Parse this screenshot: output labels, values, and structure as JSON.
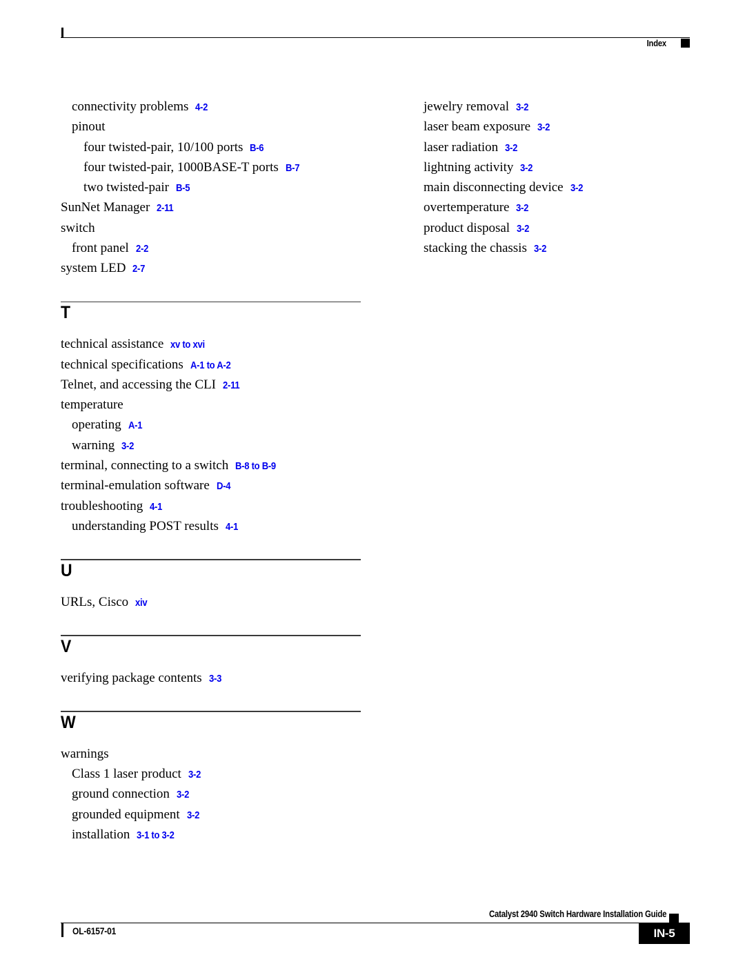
{
  "header": {
    "label": "Index",
    "marker": "black-square"
  },
  "colors": {
    "page_reference": "#0000ee",
    "text": "#000000",
    "rule": "#3a3a3a"
  },
  "columns": {
    "left": {
      "entries": [
        {
          "term": "connectivity problems",
          "ref": "4-2",
          "level": 1
        },
        {
          "term": "pinout",
          "ref": "",
          "level": 1
        },
        {
          "term": "four twisted-pair, 10/100 ports",
          "ref": "B-6",
          "level": 2
        },
        {
          "term": "four twisted-pair, 1000BASE-T ports",
          "ref": "B-7",
          "level": 2
        },
        {
          "term": "two twisted-pair",
          "ref": "B-5",
          "level": 2
        },
        {
          "term": "SunNet Manager",
          "ref": "2-11",
          "level": 0
        },
        {
          "term": "switch",
          "ref": "",
          "level": 0
        },
        {
          "term": "front panel",
          "ref": "2-2",
          "level": 1
        },
        {
          "term": "system LED",
          "ref": "2-7",
          "level": 0
        }
      ],
      "sections": [
        {
          "letter": "T",
          "entries": [
            {
              "term": "technical assistance",
              "ref": "xv to xvi",
              "level": 0
            },
            {
              "term": "technical specifications",
              "ref": "A-1 to A-2",
              "level": 0
            },
            {
              "term": "Telnet, and accessing the CLI",
              "ref": "2-11",
              "level": 0
            },
            {
              "term": "temperature",
              "ref": "",
              "level": 0
            },
            {
              "term": "operating",
              "ref": "A-1",
              "level": 1
            },
            {
              "term": "warning",
              "ref": "3-2",
              "level": 1
            },
            {
              "term": "terminal, connecting to a switch",
              "ref": "B-8 to B-9",
              "level": 0
            },
            {
              "term": "terminal-emulation software",
              "ref": "D-4",
              "level": 0
            },
            {
              "term": "troubleshooting",
              "ref": "4-1",
              "level": 0
            },
            {
              "term": "understanding POST results",
              "ref": "4-1",
              "level": 1
            }
          ]
        },
        {
          "letter": "U",
          "entries": [
            {
              "term": "URLs, Cisco",
              "ref": "xiv",
              "level": 0
            }
          ]
        },
        {
          "letter": "V",
          "entries": [
            {
              "term": "verifying package contents",
              "ref": "3-3",
              "level": 0
            }
          ]
        },
        {
          "letter": "W",
          "entries": [
            {
              "term": "warnings",
              "ref": "",
              "level": 0
            },
            {
              "term": "Class 1 laser product",
              "ref": "3-2",
              "level": 1
            },
            {
              "term": "ground connection",
              "ref": "3-2",
              "level": 1
            },
            {
              "term": "grounded equipment",
              "ref": "3-2",
              "level": 1
            },
            {
              "term": "installation",
              "ref": "3-1 to 3-2",
              "level": 1
            }
          ]
        }
      ]
    },
    "right": {
      "entries": [
        {
          "term": "jewelry removal",
          "ref": "3-2",
          "level": 1
        },
        {
          "term": "laser beam exposure",
          "ref": "3-2",
          "level": 1
        },
        {
          "term": "laser radiation",
          "ref": "3-2",
          "level": 1
        },
        {
          "term": "lightning activity",
          "ref": "3-2",
          "level": 1
        },
        {
          "term": "main disconnecting device",
          "ref": "3-2",
          "level": 1
        },
        {
          "term": "overtemperature",
          "ref": "3-2",
          "level": 1
        },
        {
          "term": "product disposal",
          "ref": "3-2",
          "level": 1
        },
        {
          "term": "stacking the chassis",
          "ref": "3-2",
          "level": 1
        }
      ]
    }
  },
  "footer": {
    "guide_title": "Catalyst 2940 Switch Hardware Installation Guide",
    "doc_number": "OL-6157-01",
    "page_number": "IN-5",
    "marker": "black-square"
  }
}
